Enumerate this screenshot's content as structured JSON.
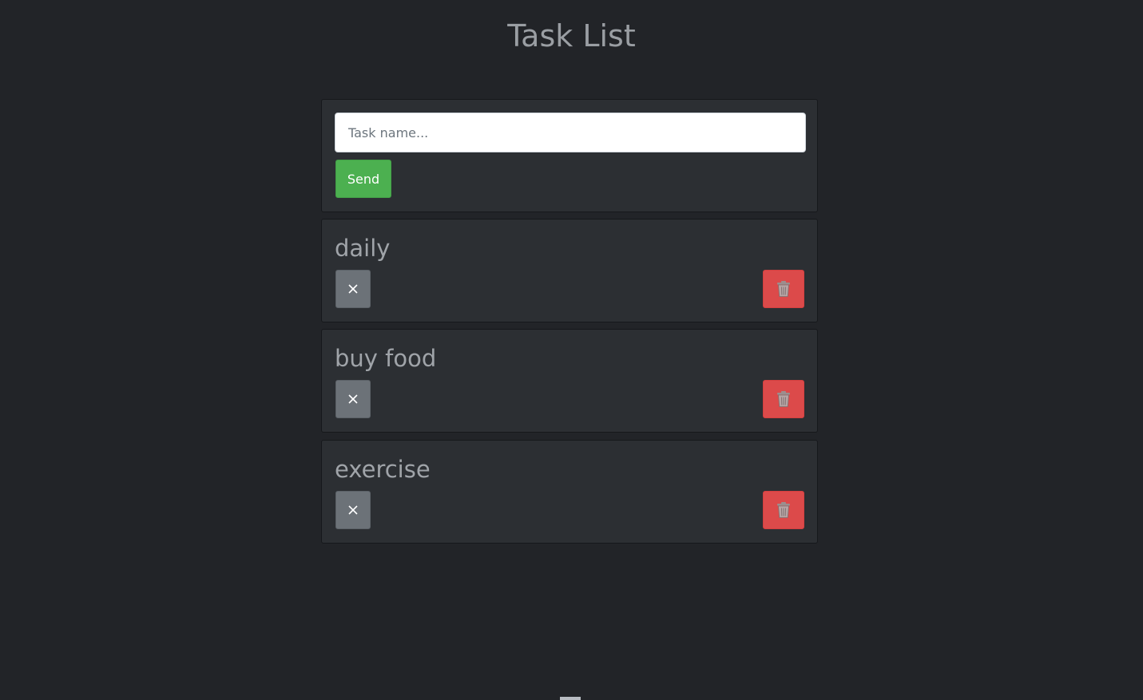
{
  "page": {
    "title": "Task List"
  },
  "form": {
    "placeholder": "Task name...",
    "value": "",
    "send_label": "Send"
  },
  "tasks": [
    {
      "name": "daily",
      "done_icon": "close-icon",
      "delete_icon": "trash-icon"
    },
    {
      "name": "buy food",
      "done_icon": "close-icon",
      "delete_icon": "trash-icon"
    },
    {
      "name": "exercise",
      "done_icon": "close-icon",
      "delete_icon": "trash-icon"
    }
  ],
  "colors": {
    "background": "#222428",
    "card": "#2c2f33",
    "send": "#4cb050",
    "done": "#6c7278",
    "delete": "#dc4a4a"
  }
}
